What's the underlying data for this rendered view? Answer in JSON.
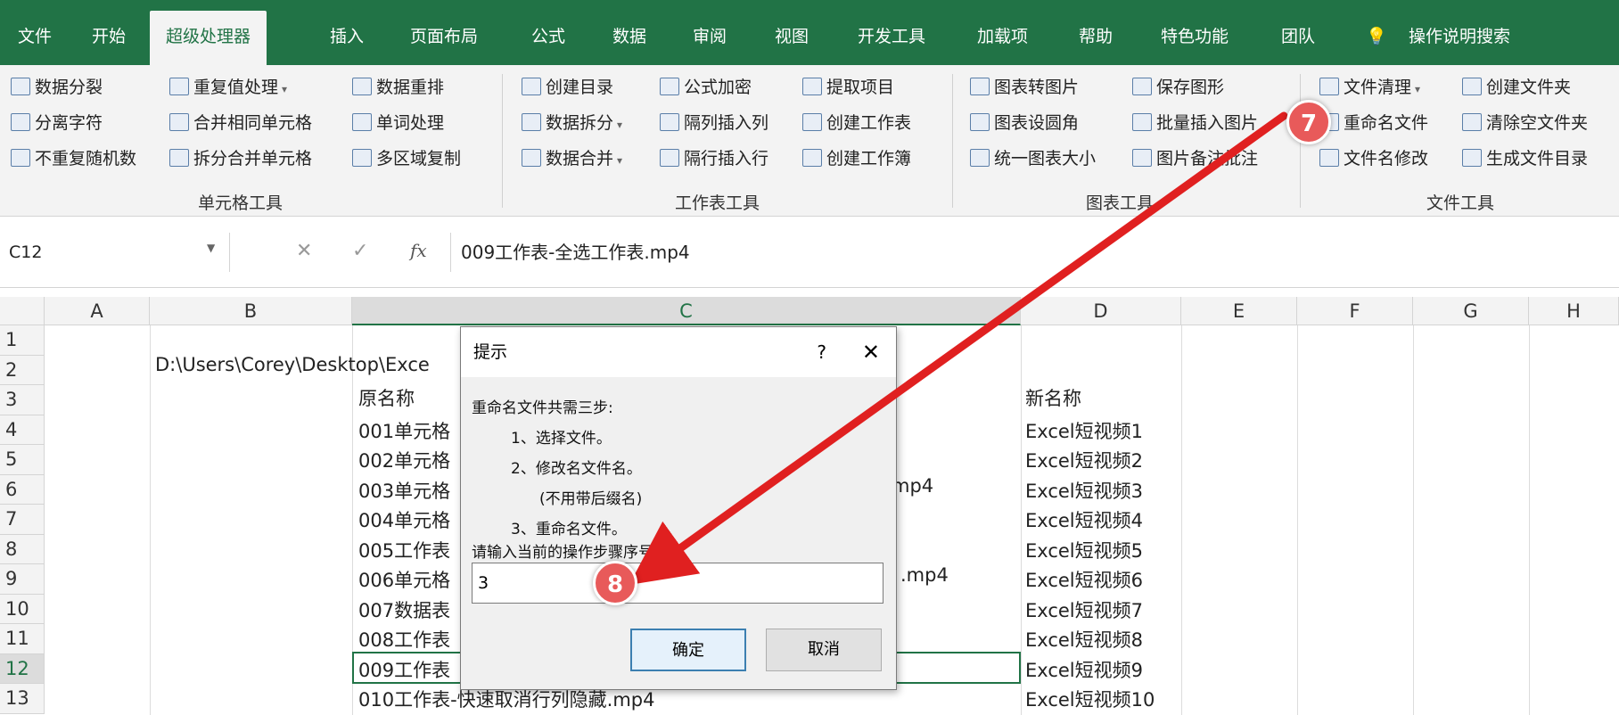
{
  "tabs": [
    "文件",
    "开始",
    "超级处理器",
    "插入",
    "页面布局",
    "公式",
    "数据",
    "审阅",
    "视图",
    "开发工具",
    "加载项",
    "帮助",
    "特色功能",
    "团队",
    "操作说明搜索"
  ],
  "ribbon": {
    "cell_tools": {
      "label": "单元格工具",
      "items": [
        "数据分裂",
        "分离字符",
        "不重复随机数",
        "重复值处理",
        "合并相同单元格",
        "拆分合并单元格",
        "数据重排",
        "单词处理",
        "多区域复制"
      ]
    },
    "sheet_tools": {
      "label": "工作表工具",
      "items": [
        "创建目录",
        "数据拆分",
        "数据合并",
        "公式加密",
        "隔列插入列",
        "隔行插入行",
        "提取项目",
        "创建工作表",
        "创建工作簿"
      ]
    },
    "chart_tools": {
      "label": "图表工具",
      "items": [
        "图表转图片",
        "图表设圆角",
        "统一图表大小",
        "保存图形",
        "批量插入图片",
        "图片备注批注"
      ]
    },
    "file_tools": {
      "label": "文件工具",
      "items": [
        "文件清理",
        "重命名文件",
        "文件名修改",
        "创建文件夹",
        "清除空文件夹",
        "生成文件目录"
      ]
    }
  },
  "formula_bar": {
    "name_box": "C12",
    "fx": "fx",
    "content": "009工作表-全选工作表.mp4"
  },
  "columns": [
    "A",
    "B",
    "C",
    "D",
    "E",
    "F",
    "G",
    "H"
  ],
  "rows": [
    "1",
    "2",
    "3",
    "4",
    "5",
    "6",
    "7",
    "8",
    "9",
    "10",
    "11",
    "12",
    "13"
  ],
  "cells": {
    "b2": "D:\\Users\\Corey\\Desktop\\Exce",
    "c3": "原名称",
    "d3": "新名称",
    "c": [
      "001单元格",
      "002单元格",
      "003单元格",
      "004单元格",
      "005工作表",
      "006单元格",
      "007数据表",
      "008工作表",
      "009工作表",
      "010工作表-快速取消行列隐藏.mp4"
    ],
    "c6_tail": "mp4",
    "c9_tail": ".mp4",
    "d": [
      "Excel短视频1",
      "Excel短视频2",
      "Excel短视频3",
      "Excel短视频4",
      "Excel短视频5",
      "Excel短视频6",
      "Excel短视频7",
      "Excel短视频8",
      "Excel短视频9",
      "Excel短视频10"
    ]
  },
  "dialog": {
    "title": "提示",
    "help": "?",
    "close": "✕",
    "lines": [
      "重命名文件共需三步:",
      "1、选择文件。",
      "2、修改名文件名。",
      "(不用带后缀名)",
      "3、重命名文件。",
      "请输入当前的操作步骤序号"
    ],
    "input_value": "3",
    "ok": "确定",
    "cancel": "取消"
  },
  "badges": [
    "7",
    "8"
  ],
  "colors": {
    "excel_green": "#217346",
    "arrow": "#e02020",
    "badge": "#e85a5a"
  }
}
